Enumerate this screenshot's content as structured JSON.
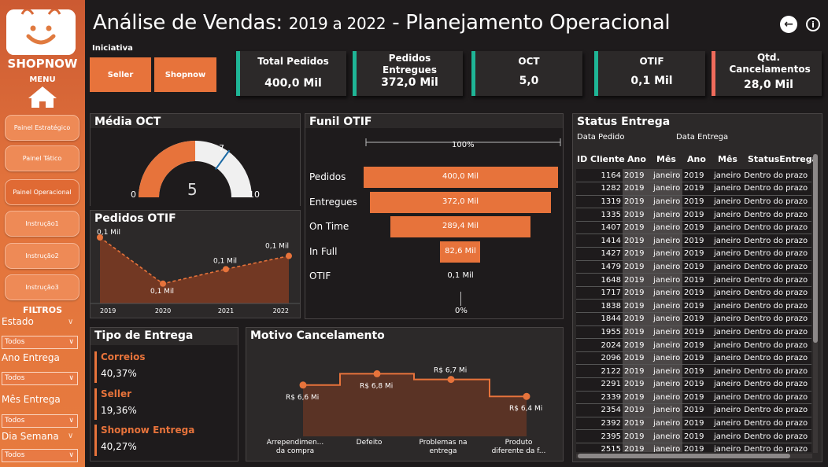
{
  "sidebar": {
    "brand": "SHOPNOW",
    "menu_label": "MENU",
    "nav": [
      "Painel Estratégico",
      "Painel Tático",
      "Painel Operacional",
      "Instrução1",
      "Instrução2",
      "Instrução3"
    ],
    "filters_label": "FILTROS",
    "filters": [
      {
        "label": "Estado",
        "value": "Todos"
      },
      {
        "label": "Ano Entrega",
        "value": "Todos"
      },
      {
        "label": "Mês Entrega",
        "value": "Todos"
      },
      {
        "label": "Dia Semana",
        "value": "Todos"
      }
    ]
  },
  "header": {
    "title_main": "Análise de Vendas:",
    "title_years": "2019 a 2022",
    "title_rest": "- Planejamento Operacional",
    "initiative_label": "Iniciativa",
    "initiative_buttons": [
      "Seller",
      "Shopnow"
    ],
    "icons": [
      "back-arrow-icon",
      "info-icon"
    ]
  },
  "kpis": [
    {
      "title": "Total Pedidos",
      "value": "400,0 Mil",
      "accent": "#1fb596"
    },
    {
      "title": "Pedidos Entregues",
      "value": "372,0 Mil",
      "accent": "#1fb596"
    },
    {
      "title": "OCT",
      "value": "5,0",
      "accent": "#1fb596"
    },
    {
      "title": "OTIF",
      "value": "0,1 Mil",
      "accent": "#1fb596"
    },
    {
      "title": "Qtd. Cancelamentos",
      "value": "28,0 Mil",
      "accent": "#f06b5b"
    }
  ],
  "media_oct": {
    "title": "Média OCT",
    "min": "0",
    "max": "10",
    "target": "7",
    "value": "5"
  },
  "pedidos_otif": {
    "title": "Pedidos OTIF"
  },
  "funil": {
    "title": "Funil OTIF",
    "top_pct": "100%",
    "bottom_pct": "0%",
    "stages": [
      {
        "label": "Pedidos",
        "value": "400,0 Mil"
      },
      {
        "label": "Entregues",
        "value": "372,0 Mil"
      },
      {
        "label": "On Time",
        "value": "289,4 Mil"
      },
      {
        "label": "In Full",
        "value": "82,6 Mil"
      },
      {
        "label": "OTIF",
        "value": "0,1 Mil"
      }
    ]
  },
  "status": {
    "title": "Status Entrega",
    "sub_pedido": "Data Pedido",
    "sub_entrega": "Data Entrega",
    "columns": [
      "ID Cliente",
      "Ano",
      "Mês",
      "Ano",
      "Mês",
      "StatusEntrega"
    ],
    "rows": [
      [
        "1164",
        "2019",
        "janeiro",
        "2019",
        "janeiro",
        "Dentro do prazo"
      ],
      [
        "1282",
        "2019",
        "janeiro",
        "2019",
        "janeiro",
        "Dentro do prazo"
      ],
      [
        "1319",
        "2019",
        "janeiro",
        "2019",
        "janeiro",
        "Dentro do prazo"
      ],
      [
        "1335",
        "2019",
        "janeiro",
        "2019",
        "janeiro",
        "Dentro do prazo"
      ],
      [
        "1407",
        "2019",
        "janeiro",
        "2019",
        "janeiro",
        "Dentro do prazo"
      ],
      [
        "1414",
        "2019",
        "janeiro",
        "2019",
        "janeiro",
        "Dentro do prazo"
      ],
      [
        "1427",
        "2019",
        "janeiro",
        "2019",
        "janeiro",
        "Dentro do prazo"
      ],
      [
        "1479",
        "2019",
        "janeiro",
        "2019",
        "janeiro",
        "Dentro do prazo"
      ],
      [
        "1648",
        "2019",
        "janeiro",
        "2019",
        "janeiro",
        "Dentro do prazo"
      ],
      [
        "1717",
        "2019",
        "janeiro",
        "2019",
        "janeiro",
        "Dentro do prazo"
      ],
      [
        "1838",
        "2019",
        "janeiro",
        "2019",
        "janeiro",
        "Dentro do prazo"
      ],
      [
        "1844",
        "2019",
        "janeiro",
        "2019",
        "janeiro",
        "Dentro do prazo"
      ],
      [
        "1955",
        "2019",
        "janeiro",
        "2019",
        "janeiro",
        "Dentro do prazo"
      ],
      [
        "2024",
        "2019",
        "janeiro",
        "2019",
        "janeiro",
        "Dentro do prazo"
      ],
      [
        "2096",
        "2019",
        "janeiro",
        "2019",
        "janeiro",
        "Dentro do prazo"
      ],
      [
        "2122",
        "2019",
        "janeiro",
        "2019",
        "janeiro",
        "Dentro do prazo"
      ],
      [
        "2291",
        "2019",
        "janeiro",
        "2019",
        "janeiro",
        "Dentro do prazo"
      ],
      [
        "2339",
        "2019",
        "janeiro",
        "2019",
        "janeiro",
        "Dentro do prazo"
      ],
      [
        "2354",
        "2019",
        "janeiro",
        "2019",
        "janeiro",
        "Dentro do prazo"
      ],
      [
        "2392",
        "2019",
        "janeiro",
        "2019",
        "janeiro",
        "Dentro do prazo"
      ],
      [
        "2395",
        "2019",
        "janeiro",
        "2019",
        "janeiro",
        "Dentro do prazo"
      ],
      [
        "2515",
        "2019",
        "janeiro",
        "2019",
        "janeiro",
        "Dentro do prazo"
      ]
    ]
  },
  "tipo_entrega": {
    "title": "Tipo de Entrega",
    "items": [
      {
        "label": "Correios",
        "pct": "40,37%"
      },
      {
        "label": "Seller",
        "pct": "19,36%"
      },
      {
        "label": "Shopnow Entrega",
        "pct": "40,27%"
      }
    ]
  },
  "motivo": {
    "title": "Motivo Cancelamento"
  },
  "chart_data": [
    {
      "type": "gauge",
      "title": "Média OCT",
      "value": 5,
      "min": 0,
      "max": 10,
      "target": 7
    },
    {
      "type": "area",
      "title": "Pedidos OTIF",
      "x": [
        "2019",
        "2020",
        "2021",
        "2022"
      ],
      "values": [
        0.1,
        0.1,
        0.1,
        0.1
      ],
      "data_labels": [
        "0,1 Mil",
        "0,1 Mil",
        "0,1 Mil",
        "0,1 Mil"
      ],
      "trend": [
        1.0,
        0.3,
        0.52,
        0.72
      ]
    },
    {
      "type": "bar",
      "title": "Funil OTIF",
      "categories": [
        "Pedidos",
        "Entregues",
        "On Time",
        "In Full",
        "OTIF"
      ],
      "values": [
        400.0,
        372.0,
        289.4,
        82.6,
        0.1
      ],
      "unit": "Mil"
    },
    {
      "type": "area",
      "title": "Motivo Cancelamento",
      "categories": [
        "Arrependimen... da compra",
        "Defeito",
        "Problemas na entrega",
        "Produto diferente da f..."
      ],
      "values": [
        6.6,
        6.8,
        6.7,
        6.4
      ],
      "data_labels": [
        "R$ 6,6 Mi",
        "R$ 6,8 Mi",
        "R$ 6,7 Mi",
        "R$ 6,4 Mi"
      ]
    }
  ]
}
